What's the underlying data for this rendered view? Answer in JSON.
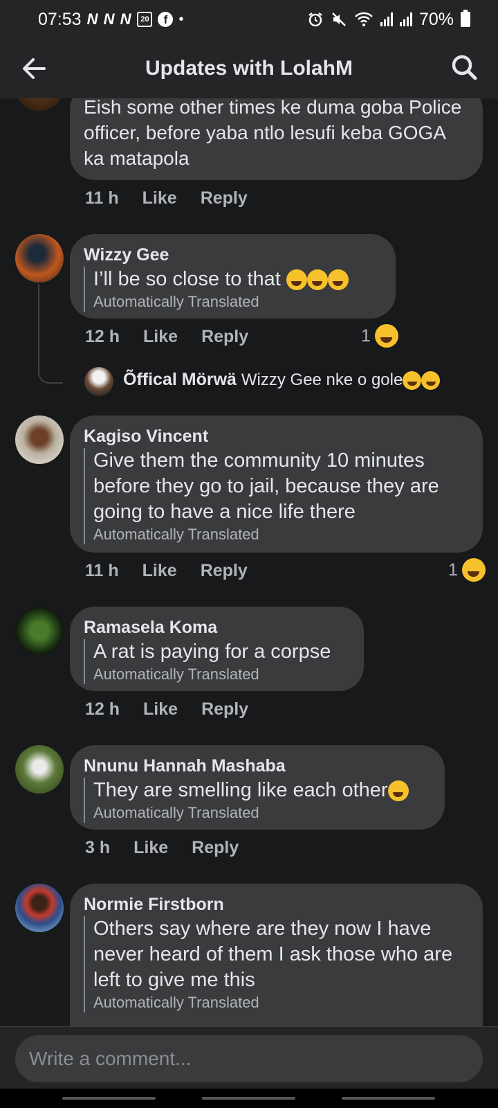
{
  "status_bar": {
    "time": "07:53",
    "notification_letters": "N N N",
    "calendar_day": "20",
    "facebook_glyph": "f",
    "dot": "•",
    "battery": "70%"
  },
  "header": {
    "title": "Updates with LolahM"
  },
  "comments": [
    {
      "name": "",
      "text": "Eish some other times ke duma goba Police officer, before yaba ntlo lesufi keba GOGA ka matapola",
      "time": "11 h",
      "like": "Like",
      "reply": "Reply"
    },
    {
      "name": "Wizzy Gee",
      "text": "I’ll be so close to that",
      "translated_label": "Automatically Translated",
      "time": "12 h",
      "like": "Like",
      "reply": "Reply",
      "reaction_count": "1",
      "reply_preview": {
        "name": "Õffical Mörwä",
        "text": "Wizzy Gee nke o gole"
      }
    },
    {
      "name": "Kagiso Vincent",
      "text": "Give them the community 10 minutes before they go to jail, because they are going to have a nice life there",
      "translated_label": "Automatically Translated",
      "time": "11 h",
      "like": "Like",
      "reply": "Reply",
      "reaction_count": "1"
    },
    {
      "name": "Ramasela Koma",
      "text": "A rat is paying for a corpse",
      "translated_label": "Automatically Translated",
      "time": "12 h",
      "like": "Like",
      "reply": "Reply"
    },
    {
      "name": "Nnunu Hannah Mashaba",
      "text": "They are smelling like each other",
      "translated_label": "Automatically Translated",
      "time": "3 h",
      "like": "Like",
      "reply": "Reply"
    },
    {
      "name": "Normie Firstborn",
      "text": "Others say where are they now I have never heard of them I ask those who are left to give me this",
      "translated_label": "Automatically Translated"
    }
  ],
  "composer": {
    "placeholder": "Write a comment..."
  },
  "colors": {
    "background": "#18191a",
    "bubble": "#3a3b3c",
    "bar": "#242526",
    "text": "#e4e6eb",
    "secondary": "#b0b3b8"
  }
}
